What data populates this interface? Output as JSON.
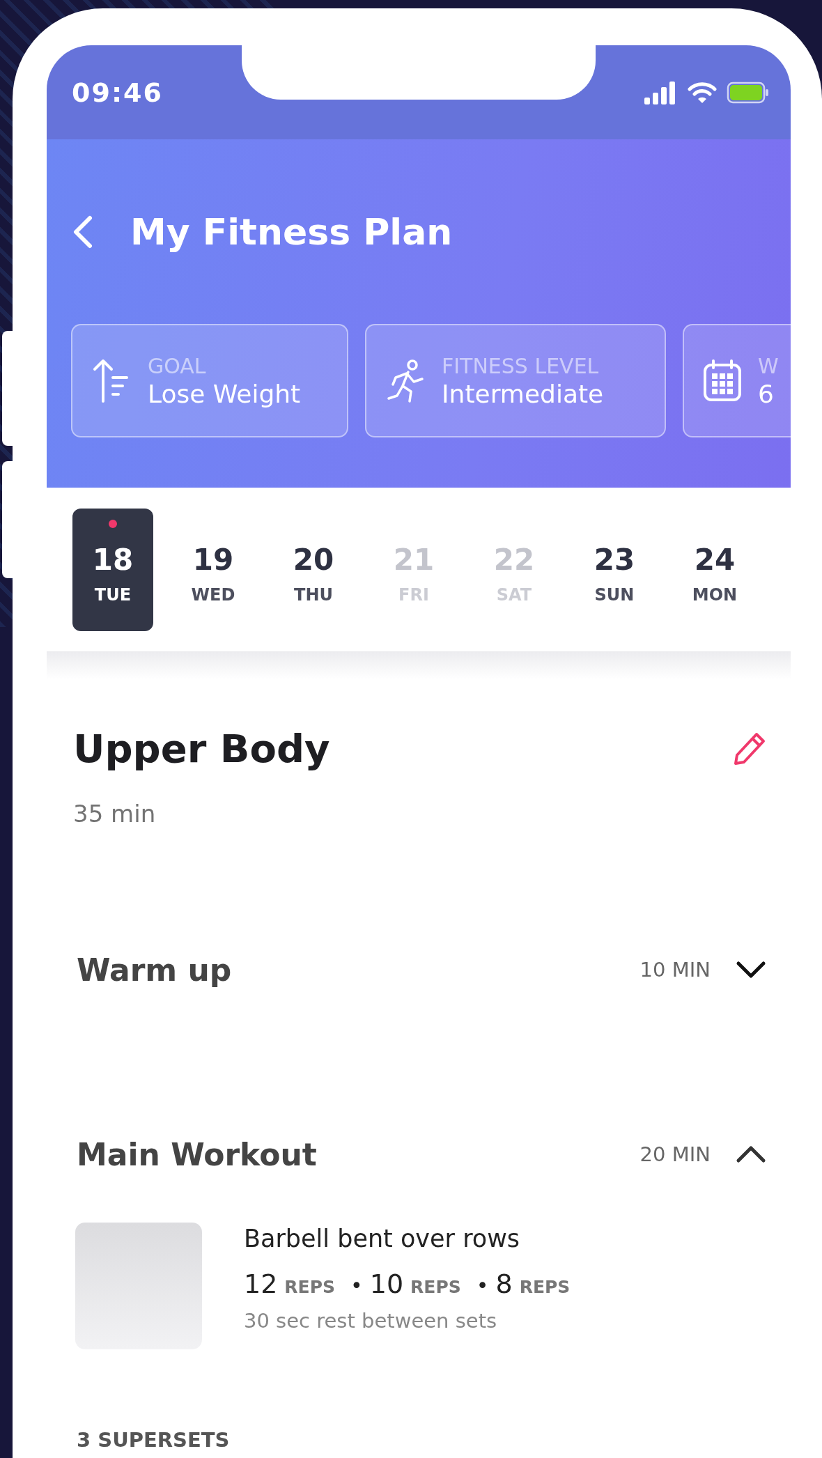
{
  "status_bar": {
    "time": "09:46"
  },
  "header": {
    "title": "My Fitness Plan"
  },
  "summary_cards": [
    {
      "kind": "goal",
      "label": "GOAL",
      "value": "Lose Weight"
    },
    {
      "kind": "level",
      "label": "FITNESS LEVEL",
      "value": "Intermediate"
    },
    {
      "kind": "schedule",
      "label": "W",
      "value": "6"
    }
  ],
  "days": [
    {
      "number": "18",
      "weekday": "TUE",
      "selected": true,
      "disabled": false,
      "marked": true
    },
    {
      "number": "19",
      "weekday": "WED",
      "selected": false,
      "disabled": false,
      "marked": false
    },
    {
      "number": "20",
      "weekday": "THU",
      "selected": false,
      "disabled": false,
      "marked": false
    },
    {
      "number": "21",
      "weekday": "FRI",
      "selected": false,
      "disabled": true,
      "marked": false
    },
    {
      "number": "22",
      "weekday": "SAT",
      "selected": false,
      "disabled": true,
      "marked": false
    },
    {
      "number": "23",
      "weekday": "SUN",
      "selected": false,
      "disabled": false,
      "marked": false
    },
    {
      "number": "24",
      "weekday": "MON",
      "selected": false,
      "disabled": false,
      "marked": false
    }
  ],
  "workout": {
    "title": "Upper Body",
    "duration": "35 min"
  },
  "sections": [
    {
      "title": "Warm up",
      "duration": "10 MIN",
      "expanded": false
    },
    {
      "title": "Main Workout",
      "duration": "20 MIN",
      "expanded": true,
      "exercises": [
        {
          "name": "Barbell bent over rows",
          "sets": [
            {
              "count": "12",
              "unit": "REPS"
            },
            {
              "separator": "•",
              "count": "10",
              "unit": "REPS"
            },
            {
              "separator": "•",
              "count": "8",
              "unit": "REPS"
            }
          ],
          "rest": "30 sec rest between sets"
        }
      ]
    }
  ],
  "supersets_heading": "3 SUPERSETS"
}
